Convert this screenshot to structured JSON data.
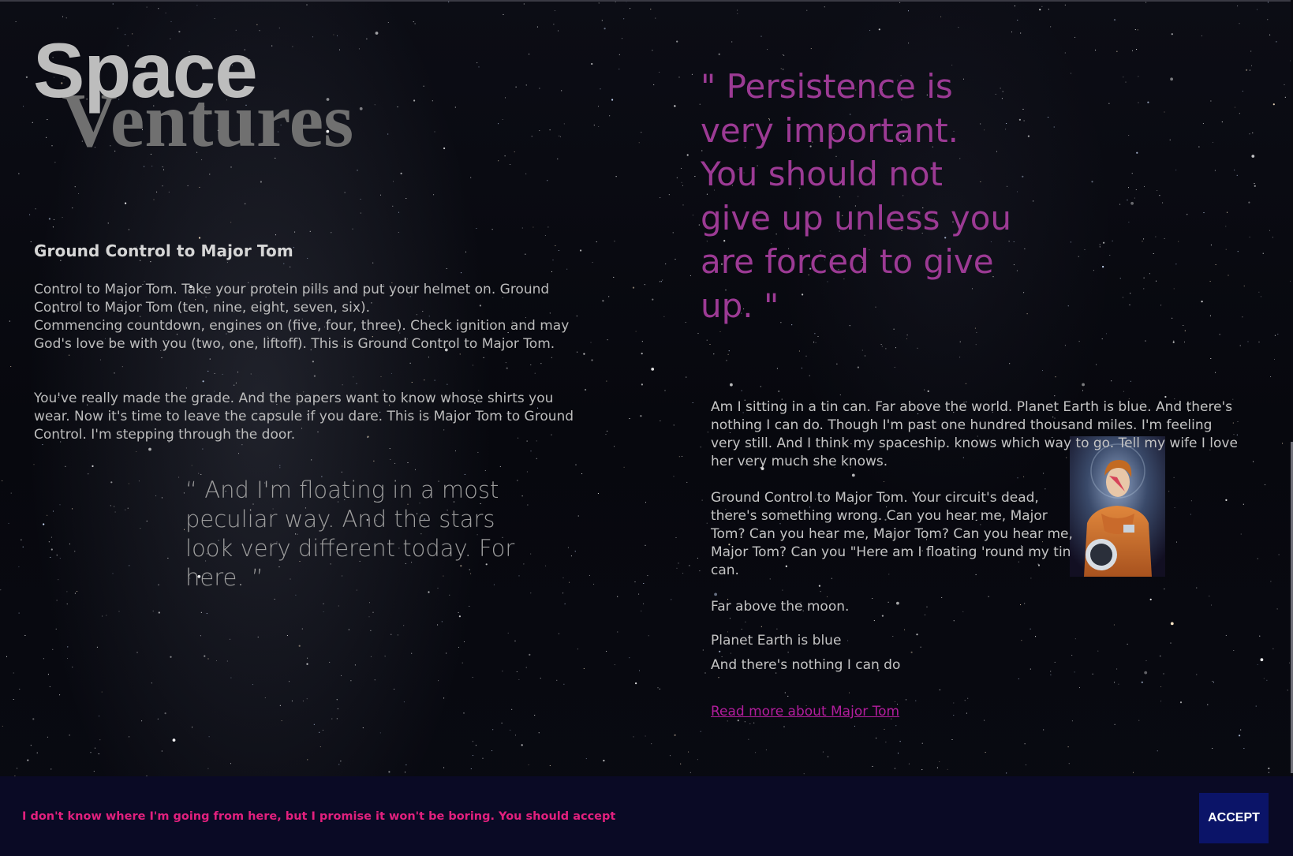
{
  "brand": {
    "word1": "Space",
    "word2": "Ventures"
  },
  "left": {
    "heading": "Ground Control to Major Tom",
    "paragraph1": "Control to Major Tom. Take your protein pills and put your helmet on. Ground Control to Major Tom (ten, nine, eight, seven, six).\nCommencing countdown, engines on (five, four, three). Check ignition and may God's love be with you (two, one, liftoff). This is Ground Control to Major Tom.",
    "paragraph2": "You've really made the grade. And the papers want to know whose shirts you wear. Now it's time to leave the capsule if you dare. This is Major Tom to Ground Control. I'm stepping through the door.",
    "quote": "“ And I'm floating in a most peculiar way. And the stars look very different today. For here. ”"
  },
  "right": {
    "quote": "\" Persistence is very important. You should not give up unless you are forced to give up. \"",
    "paragraph1": "Am I sitting in a tin can. Far above the world. Planet Earth is blue. And there's nothing I can do. Though I'm past one hundred thousand miles. I'm feeling very still. And I think my spaceship. knows which way to go. Tell my wife I love her very much she knows.",
    "paragraph2": "Ground Control to Major Tom. Your circuit's dead, there's something wrong. Can you hear me, Major Tom? Can you hear me, Major Tom? Can you hear me, Major Tom? Can you \"Here am I floating 'round my tin can.",
    "line1": "Far above the moon.",
    "line2": "Planet Earth is blue",
    "line3": "And there's nothing I can do",
    "link": "Read more about Major Tom"
  },
  "cookie": {
    "message": "I don't know where I'm going from here, but I promise it won't be boring. You should accept",
    "accept_label": "ACCEPT"
  },
  "colors": {
    "quote_purple": "#9c3a94",
    "link_magenta": "#b31d9d",
    "cookie_text": "#e2207e",
    "cookie_bar": "#0a0a25",
    "accept_button": "#0b1468"
  },
  "icons": {
    "astronaut_image": "astronaut-portrait"
  }
}
